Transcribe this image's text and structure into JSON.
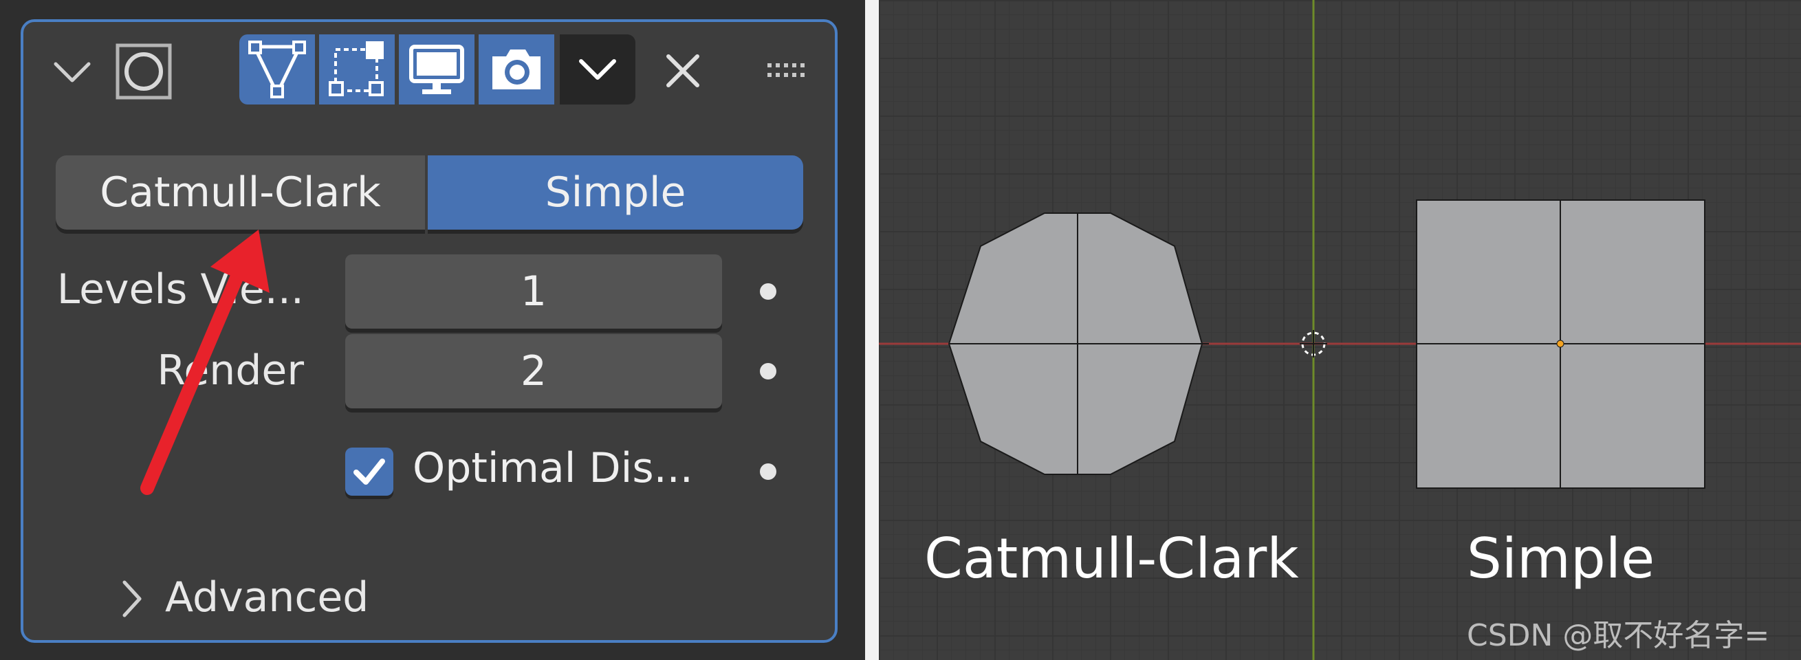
{
  "modifier_panel": {
    "header": {
      "collapse_icon": "chevron-down-icon",
      "modifier_type_icon": "subdivision-surface-icon",
      "toggles": [
        {
          "name": "edit-mode",
          "icon": "edit-mode-icon",
          "active": true
        },
        {
          "name": "on-cage",
          "icon": "on-cage-icon",
          "active": true
        },
        {
          "name": "realtime",
          "icon": "monitor-icon",
          "active": true
        },
        {
          "name": "render",
          "icon": "camera-icon",
          "active": true
        }
      ],
      "extra_menu_icon": "chevron-down-icon",
      "close_icon": "close-icon",
      "drag_icon": "drag-handle-icon"
    },
    "method_tabs": [
      "Catmull-Clark",
      "Simple"
    ],
    "active_method": "Simple",
    "levels_viewport": {
      "label": "Levels Vie...",
      "value": "1"
    },
    "render_levels": {
      "label": "Render",
      "value": "2"
    },
    "optimal_display": {
      "label": "Optimal Dis...",
      "checked": true
    },
    "advanced": {
      "label": "Advanced",
      "expanded": false
    }
  },
  "annotation": {
    "type": "arrow",
    "color": "#e8222b"
  },
  "viewport": {
    "left_caption": "Catmull-Clark",
    "right_caption": "Simple",
    "watermark": "CSDN @取不好名字="
  },
  "colors": {
    "accent": "#4772b3",
    "panel_bg": "#3d3d3d",
    "panel_border": "#4a7fc4",
    "mesh_face": "#a6a7a9",
    "x_axis": "#9a3a3a",
    "y_axis": "#6e8c2a"
  }
}
